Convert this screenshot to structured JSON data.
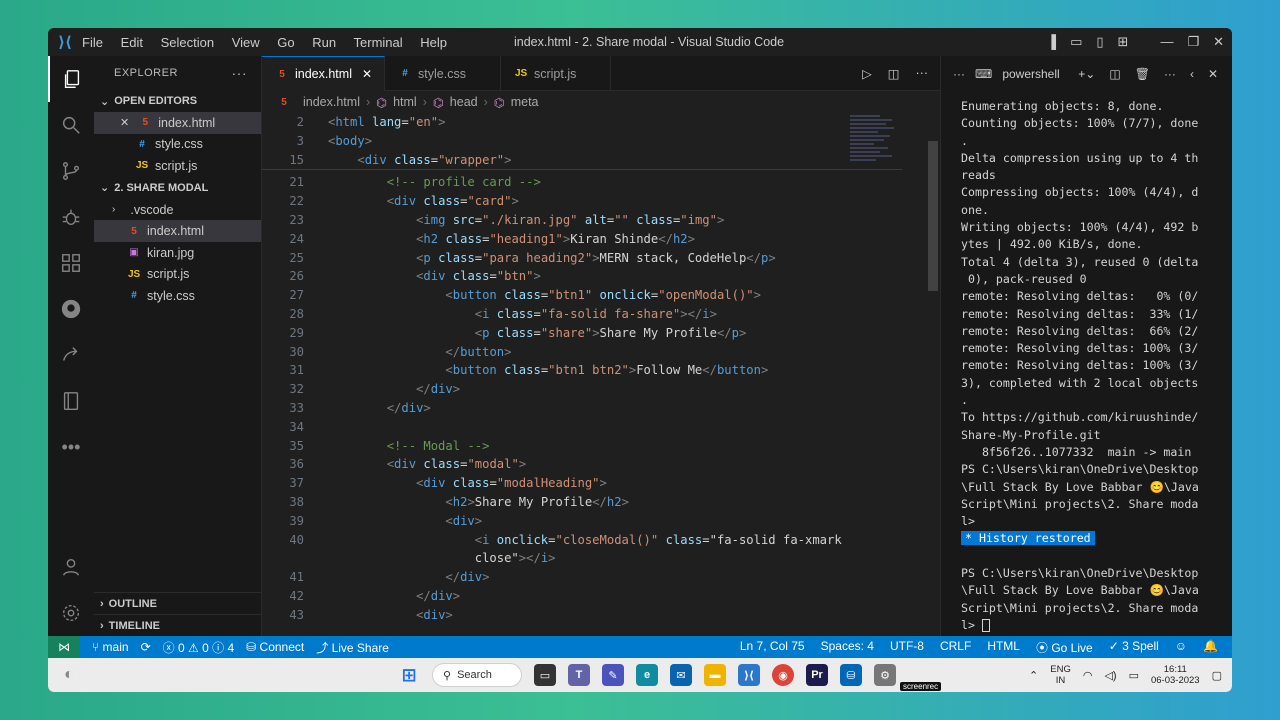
{
  "window": {
    "title": "index.html - 2. Share modal - Visual Studio Code",
    "menu": [
      "File",
      "Edit",
      "Selection",
      "View",
      "Go",
      "Run",
      "Terminal",
      "Help"
    ]
  },
  "explorer": {
    "header": "EXPLORER",
    "open_editors_label": "OPEN EDITORS",
    "open_editors": [
      "index.html",
      "style.css",
      "script.js"
    ],
    "folder_label": "2. SHARE MODAL",
    "files": [
      ".vscode",
      "index.html",
      "kiran.jpg",
      "script.js",
      "style.css"
    ],
    "outline_label": "OUTLINE",
    "timeline_label": "TIMELINE"
  },
  "tabs": [
    "index.html",
    "style.css",
    "script.js"
  ],
  "breadcrumb": [
    "index.html",
    "html",
    "head",
    "meta"
  ],
  "editor": {
    "sticky": [
      {
        "n": "2",
        "code": "<html lang=\"en\">"
      },
      {
        "n": "3",
        "code": "<body>"
      },
      {
        "n": "15",
        "code": "    <div class=\"wrapper\">"
      }
    ],
    "lines": [
      {
        "n": "21",
        "code": "        <!-- profile card -->"
      },
      {
        "n": "22",
        "code": "        <div class=\"card\">"
      },
      {
        "n": "23",
        "code": "            <img src=\"./kiran.jpg\" alt=\"\" class=\"img\">"
      },
      {
        "n": "24",
        "code": "            <h2 class=\"heading1\">Kiran Shinde</h2>"
      },
      {
        "n": "25",
        "code": "            <p class=\"para heading2\">MERN stack, CodeHelp</p>"
      },
      {
        "n": "26",
        "code": "            <div class=\"btn\">"
      },
      {
        "n": "27",
        "code": "                <button class=\"btn1\" onclick=\"openModal()\">"
      },
      {
        "n": "28",
        "code": "                    <i class=\"fa-solid fa-share\"></i>"
      },
      {
        "n": "29",
        "code": "                    <p class=\"share\">Share My Profile</p>"
      },
      {
        "n": "30",
        "code": "                </button>"
      },
      {
        "n": "31",
        "code": "                <button class=\"btn1 btn2\">Follow Me</button>"
      },
      {
        "n": "32",
        "code": "            </div>"
      },
      {
        "n": "33",
        "code": "        </div>"
      },
      {
        "n": "34",
        "code": ""
      },
      {
        "n": "35",
        "code": "        <!-- Modal -->"
      },
      {
        "n": "36",
        "code": "        <div class=\"modal\">"
      },
      {
        "n": "37",
        "code": "            <div class=\"modalHeading\">"
      },
      {
        "n": "38",
        "code": "                <h2>Share My Profile</h2>"
      },
      {
        "n": "39",
        "code": "                <div>"
      },
      {
        "n": "40",
        "code": "                    <i onclick=\"closeModal()\" class=\"fa-solid fa-xmark"
      },
      {
        "n": "",
        "code": "                    close\"></i>"
      },
      {
        "n": "41",
        "code": "                </div>"
      },
      {
        "n": "42",
        "code": "            </div>"
      },
      {
        "n": "43",
        "code": "            <div>"
      }
    ]
  },
  "terminal": {
    "shell": "powershell",
    "lines": [
      "Enumerating objects: 8, done.",
      "Counting objects: 100% (7/7), done",
      ".",
      "Delta compression using up to 4 th",
      "reads",
      "Compressing objects: 100% (4/4), d",
      "one.",
      "Writing objects: 100% (4/4), 492 b",
      "ytes | 492.00 KiB/s, done.",
      "Total 4 (delta 3), reused 0 (delta",
      " 0), pack-reused 0",
      "remote: Resolving deltas:   0% (0/",
      "remote: Resolving deltas:  33% (1/",
      "remote: Resolving deltas:  66% (2/",
      "remote: Resolving deltas: 100% (3/",
      "remote: Resolving deltas: 100% (3/",
      "3), completed with 2 local objects",
      ".",
      "To https://github.com/kiruushinde/",
      "Share-My-Profile.git",
      "   8f56f26..1077332  main -> main",
      "PS C:\\Users\\kiran\\OneDrive\\Desktop",
      "\\Full Stack By Love Babbar 😊\\Java",
      "Script\\Mini projects\\2. Share moda",
      "l>"
    ],
    "history_badge": "History restored",
    "prompt_lines": [
      "PS C:\\Users\\kiran\\OneDrive\\Desktop",
      "\\Full Stack By Love Babbar 😊\\Java",
      "Script\\Mini projects\\2. Share moda",
      "l> "
    ]
  },
  "status": {
    "branch": "main",
    "errors": "0",
    "warnings": "0",
    "info": "4",
    "connect": "Connect",
    "live_share": "Live Share",
    "position": "Ln 7, Col 75",
    "spaces": "Spaces: 4",
    "encoding": "UTF-8",
    "eol": "CRLF",
    "language": "HTML",
    "go_live": "Go Live",
    "spell": "3 Spell"
  },
  "taskbar": {
    "search": "Search",
    "lang_top": "ENG",
    "lang_bottom": "IN",
    "time": "16:11",
    "date": "06-03-2023",
    "rec_badge": "screenrec"
  },
  "colors": {
    "accent": "#007acc",
    "editor_bg": "#1f1f1f",
    "keyword": "#569cd6",
    "attribute": "#9cdcfe",
    "string": "#ce9178",
    "comment": "#6a9955"
  }
}
